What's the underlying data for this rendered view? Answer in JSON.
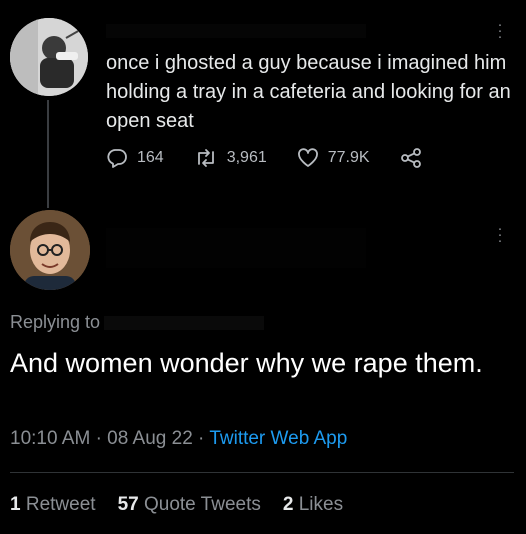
{
  "top_tweet": {
    "text": "once i ghosted a guy because i imagined him holding a tray in a cafeteria and looking for an open seat",
    "replies": "164",
    "retweets": "3,961",
    "likes": "77.9K",
    "icons": [
      "reply-icon",
      "retweet-icon",
      "like-icon",
      "share-icon",
      "more-icon"
    ]
  },
  "reply_tweet": {
    "replying_to_label": "Replying to",
    "text": "And women wonder why we rape them.",
    "time": "10:10 AM",
    "date": "08 Aug 22",
    "separator": "·",
    "source": "Twitter Web App",
    "stats": {
      "retweets_count": "1",
      "retweets_label": "Retweet",
      "quote_count": "57",
      "quote_label": "Quote Tweets",
      "likes_count": "2",
      "likes_label": "Likes"
    }
  },
  "colors": {
    "background": "#000000",
    "text": "#e7e9ea",
    "muted": "#8b8f94",
    "link": "#1d9bf0"
  }
}
